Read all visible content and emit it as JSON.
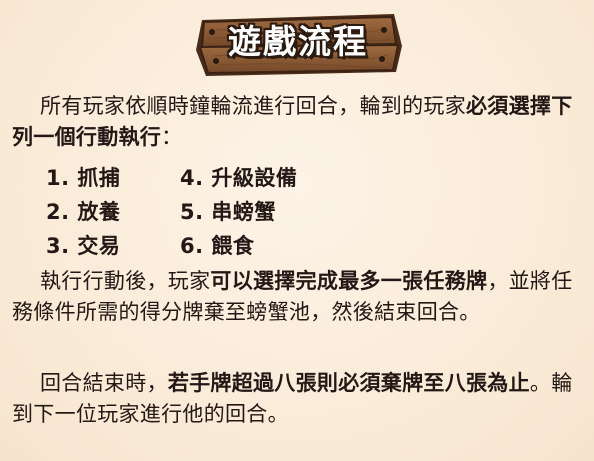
{
  "title": "遊戲流程",
  "intro": {
    "normal": "所有玩家依順時鐘輪流進行回合，輪到的玩家",
    "bold": "必須選擇下列一個行動執行",
    "end": "："
  },
  "actions": [
    {
      "left": "1. 抓捕",
      "right": "4. 升級設備"
    },
    {
      "left": "2. 放養",
      "right": "5. 串螃蟹"
    },
    {
      "left": "3. 交易",
      "right": "6. 餵食"
    }
  ],
  "after_action": {
    "lead": "執行行動後，玩家",
    "bold": "可以選擇完成最多一張任務牌",
    "tail": "，並將任務條件所需的得分牌棄至螃蟹池，然後結束回合。"
  },
  "end_turn": {
    "lead": "回合結束時，",
    "bold": "若手牌超過八張則必須棄牌至八張為止",
    "tail": "。輪到下一位玩家進行他的回合。"
  },
  "colors": {
    "background": "#fbeedd",
    "wood": "#8a5a34",
    "wood_dark": "#4a2c18",
    "text": "#231815"
  },
  "icons": {
    "sign": "wooden-sign-icon",
    "nail": "nail-icon"
  }
}
